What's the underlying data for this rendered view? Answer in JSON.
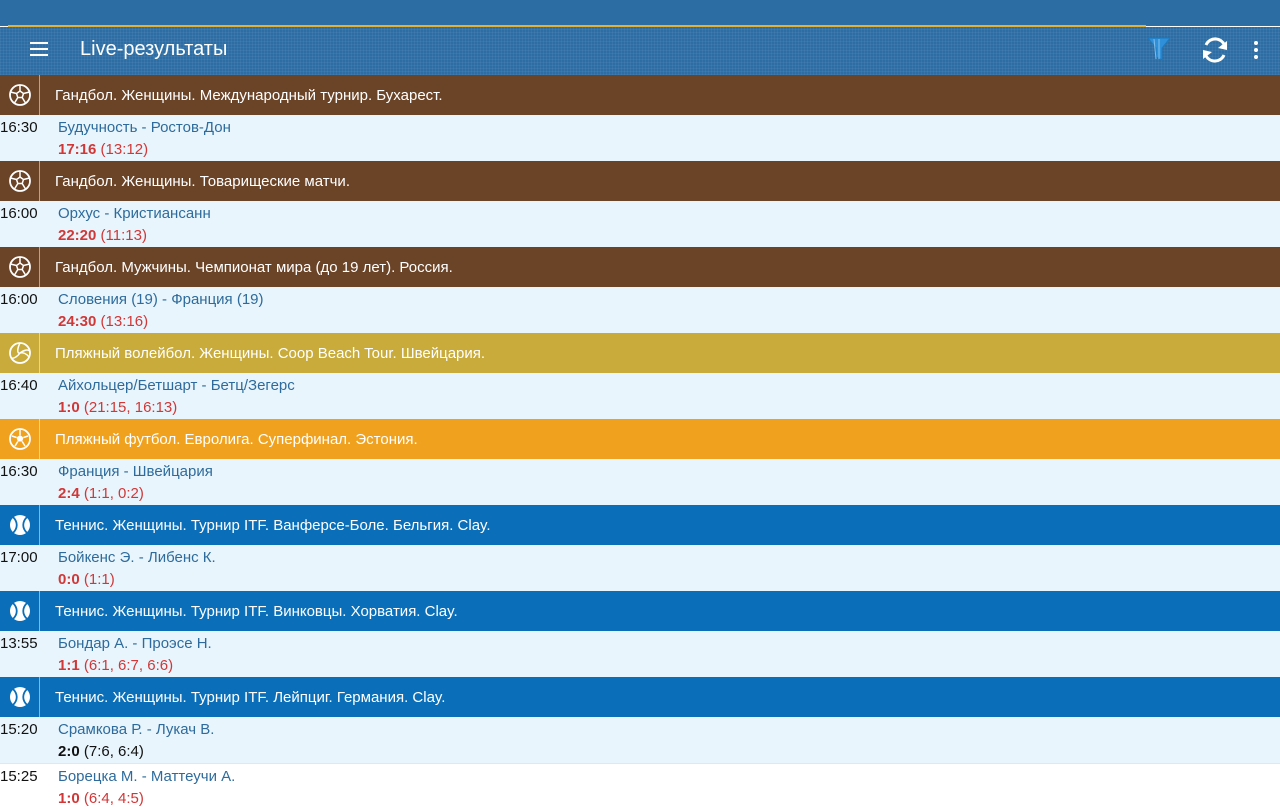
{
  "app": {
    "title": "Live-результаты",
    "colors": {
      "appbar": "#2c6da3",
      "progress": "#e2b13a",
      "handball": "#6b4428",
      "beach_volleyball": "#c8ab3a",
      "beach_soccer": "#f0a11e",
      "tennis": "#0a6fb8",
      "score_live": "#d13737",
      "teams": "#2e6b9c"
    }
  },
  "toolbar": {
    "menu_icon": "hamburger-menu-icon",
    "filter_icon": "filter-icon",
    "refresh_icon": "refresh-icon",
    "more_icon": "more-vert-icon"
  },
  "sections": [
    {
      "sport": "handball",
      "icon": "handball-ball-icon",
      "title": "Гандбол. Женщины. Международный турнир. Бухарест.",
      "matches": [
        {
          "time": "16:30",
          "teams": "Будучность - Ростов-Дон",
          "score": "17:16",
          "details": "(13:12)"
        }
      ]
    },
    {
      "sport": "handball",
      "icon": "handball-ball-icon",
      "title": "Гандбол. Женщины. Товарищеские матчи.",
      "matches": [
        {
          "time": "16:00",
          "teams": "Орхус - Кристиансанн",
          "score": "22:20",
          "details": "(11:13)"
        }
      ]
    },
    {
      "sport": "handball",
      "icon": "handball-ball-icon",
      "title": "Гандбол. Мужчины. Чемпионат мира (до 19 лет). Россия.",
      "matches": [
        {
          "time": "16:00",
          "teams": "Словения (19) - Франция (19)",
          "score": "24:30",
          "details": "(13:16)"
        }
      ]
    },
    {
      "sport": "beach_volleyball",
      "icon": "volleyball-icon",
      "title": "Пляжный волейбол. Женщины. Coop Beach Tour. Швейцария.",
      "matches": [
        {
          "time": "16:40",
          "teams": "Айхольцер/Бетшарт - Бетц/Зегерс",
          "score": "1:0",
          "details": "(21:15, 16:13)"
        }
      ]
    },
    {
      "sport": "beach_soccer",
      "icon": "soccer-ball-icon",
      "title": "Пляжный футбол. Евролига. Суперфинал. Эстония.",
      "matches": [
        {
          "time": "16:30",
          "teams": "Франция - Швейцария",
          "score": "2:4",
          "details": "(1:1, 0:2)"
        }
      ]
    },
    {
      "sport": "tennis",
      "icon": "tennis-ball-icon",
      "title": "Теннис. Женщины. Турнир ITF. Ванферсе-Боле. Бельгия. Clay.",
      "matches": [
        {
          "time": "17:00",
          "teams": "Бойкенс Э. - Либенс К.",
          "score": "0:0",
          "details": "(1:1)"
        }
      ]
    },
    {
      "sport": "tennis",
      "icon": "tennis-ball-icon",
      "title": "Теннис. Женщины. Турнир ITF. Винковцы. Хорватия. Clay.",
      "matches": [
        {
          "time": "13:55",
          "teams": "Бондар А. - Проэсе Н.",
          "score": "1:1",
          "details": "(6:1, 6:7, 6:6)"
        }
      ]
    },
    {
      "sport": "tennis",
      "icon": "tennis-ball-icon",
      "title": "Теннис. Женщины. Турнир ITF. Лейпциг. Германия. Clay.",
      "matches": [
        {
          "time": "15:20",
          "teams": "Срамкова Р. - Лукач В.",
          "score": "2:0",
          "details": "(7:6, 6:4)",
          "finished": true
        },
        {
          "time": "15:25",
          "teams": "Борецка М. - Маттеучи А.",
          "score": "1:0",
          "details": "(6:4, 4:5)"
        }
      ]
    }
  ]
}
